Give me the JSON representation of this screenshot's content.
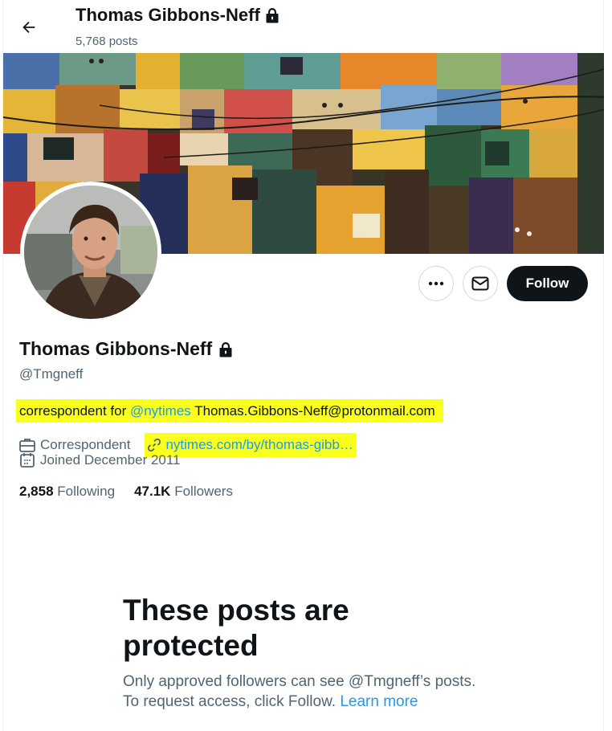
{
  "header": {
    "display_name": "Thomas Gibbons-Neff",
    "post_count": "5,768 posts"
  },
  "profile": {
    "display_name": "Thomas Gibbons-Neff",
    "handle": "@Tmgneff",
    "bio_prefix": "correspondent for ",
    "bio_mention": "@nytimes",
    "bio_suffix": " Thomas.Gibbons-Neff@protonmail.com",
    "category": "Correspondent",
    "website": "nytimes.com/by/thomas-gibb…",
    "joined": "Joined December 2011",
    "following_count": "2,858",
    "following_label": "Following",
    "followers_count": "47.1K",
    "followers_label": "Followers"
  },
  "actions": {
    "follow_label": "Follow"
  },
  "protected": {
    "title": "These posts are protected",
    "line1": "Only approved followers can see @Tmgneff’s posts.",
    "line2_prefix": "To request access, click Follow. ",
    "learn_more": "Learn more"
  },
  "icons": {
    "back": "arrow-left-icon",
    "lock": "lock-icon",
    "more": "more-dots-icon",
    "message": "envelope-icon",
    "category": "briefcase-icon",
    "link": "link-icon",
    "calendar": "calendar-icon"
  },
  "colors": {
    "accent_link": "#1d9bf0",
    "highlight": "#fbff1c",
    "follow_button": "#0f1419",
    "secondary_text": "#536471"
  }
}
